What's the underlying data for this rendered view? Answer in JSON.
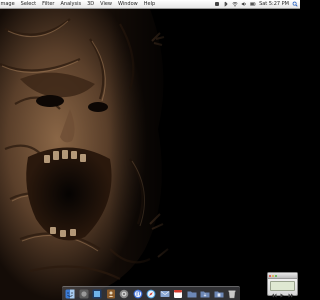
{
  "menubar": {
    "items": [
      {
        "label": "Image",
        "icon": "apple-logo-icon"
      },
      {
        "label": "Select"
      },
      {
        "label": "Filter"
      },
      {
        "label": "Analysis"
      },
      {
        "label": "3D"
      },
      {
        "label": "View"
      },
      {
        "label": "Window"
      },
      {
        "label": "Help"
      }
    ],
    "status_icons": [
      "app-indicator-icon",
      "bluetooth-icon",
      "wifi-icon",
      "volume-icon",
      "battery-icon",
      "spotlight-search-icon"
    ],
    "clock": "Sat 5:27 PM",
    "bg_color": "#ececec"
  },
  "wallpaper": {
    "subject": "screaming face made of twisted bodies",
    "dominant_color": "#5a3f2a",
    "background_color": "#000000"
  },
  "dock": {
    "items": [
      {
        "name": "finder-icon",
        "color": "#3b7bd6"
      },
      {
        "name": "app-icon",
        "color": "#5c5c5c"
      },
      {
        "name": "photoshop-icon",
        "color": "#1e3b66"
      },
      {
        "name": "address-book-icon",
        "color": "#8a5a2a"
      },
      {
        "name": "system-preferences-icon",
        "color": "#888888"
      },
      {
        "name": "itunes-icon",
        "color": "#3d6fd8"
      },
      {
        "name": "safari-icon",
        "color": "#4ea2e0"
      },
      {
        "name": "mail-icon",
        "color": "#8aa7d2"
      },
      {
        "name": "ical-icon",
        "color": "#d23a2f"
      },
      {
        "name": "folder-icon",
        "color": "#6d88b6"
      },
      {
        "name": "downloads-folder-icon",
        "color": "#6d88b6"
      },
      {
        "name": "documents-folder-icon",
        "color": "#6d88b6"
      },
      {
        "name": "trash-icon",
        "color": "#c9c9c9"
      }
    ]
  },
  "mini_player": {
    "controls": [
      "previous-track-icon",
      "play-pause-icon",
      "next-track-icon"
    ],
    "screen_color": "#dfe8d2"
  }
}
